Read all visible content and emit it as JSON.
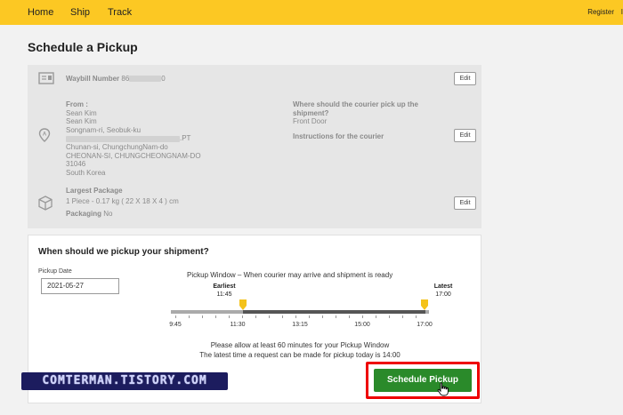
{
  "nav": {
    "items": [
      "Home",
      "Ship",
      "Track"
    ],
    "register": "Register",
    "cut_text": "I"
  },
  "page": {
    "title": "Schedule a Pickup"
  },
  "waybill": {
    "label": "Waybill Number",
    "value_prefix": "86",
    "value_suffix": "0",
    "edit": "Edit"
  },
  "address": {
    "from_label": "From :",
    "lines": [
      "Sean Kim",
      "Sean Kim",
      "Songnam-ri, Seobuk-ku"
    ],
    "line_blur_suffix": ".PT",
    "lines_after": [
      "Chunan-si, ChungchungNam-do",
      "CHEONAN-SI, CHUNGCHEONGNAM-DO",
      "31046",
      "South Korea"
    ],
    "where_label": "Where should the courier pick up the shipment?",
    "where_value": "Front Door",
    "instructions_label": "Instructions for the courier",
    "edit": "Edit"
  },
  "package": {
    "label": "Largest Package",
    "desc": "1 Piece - 0.17 kg ( 22 X 18 X 4 ) cm",
    "packaging_label": "Packaging",
    "packaging_value": "No",
    "edit": "Edit"
  },
  "pickup": {
    "question": "When should we pickup your shipment?",
    "date_label": "Pickup Date",
    "date_value": "2021-05-27",
    "window_title": "Pickup Window – When courier may arrive and shipment is ready",
    "earliest_label": "Earliest",
    "earliest_time": "11:45",
    "latest_label": "Latest",
    "latest_time": "17:00",
    "ticks": [
      "9:45",
      "11:30",
      "13:15",
      "15:00",
      "17:00"
    ],
    "note1": "Please allow at least 60 minutes for your Pickup Window",
    "note2": "The latest time a request can be made for pickup today is 14:00",
    "schedule_button": "Schedule Pickup"
  },
  "watermark": "COMTERMAN.TISTORY.COM",
  "colors": {
    "nav": "#fcc823",
    "accent": "#2a8a2a",
    "highlight": "#ee0000",
    "handle": "#f4c21a"
  }
}
